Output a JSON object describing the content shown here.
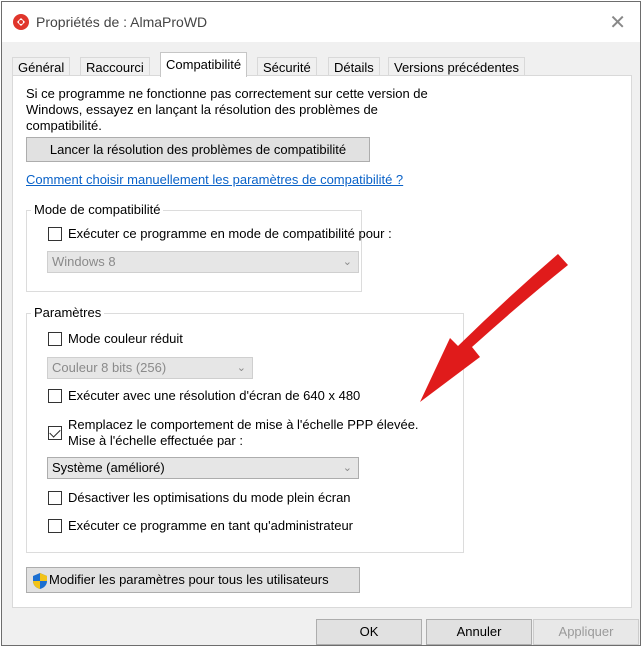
{
  "window": {
    "title": "Propriétés de : AlmaProWD",
    "close_glyph": "✕"
  },
  "tabs": [
    {
      "label": "Général"
    },
    {
      "label": "Raccourci"
    },
    {
      "label": "Compatibilité",
      "active": true
    },
    {
      "label": "Sécurité"
    },
    {
      "label": "Détails"
    },
    {
      "label": "Versions précédentes"
    }
  ],
  "intro_text": "Si ce programme ne fonctionne pas correctement sur cette version de Windows, essayez en lançant la résolution des problèmes de compatibilité.",
  "troubleshoot_button": "Lancer la résolution des problèmes de compatibilité",
  "manual_link": "Comment choisir manuellement les paramètres de compatibilité ?",
  "compat_mode": {
    "group_title": "Mode de compatibilité",
    "checkbox_label": "Exécuter ce programme en mode de compatibilité pour :",
    "checked": false,
    "select_value": "Windows 8"
  },
  "settings": {
    "group_title": "Paramètres",
    "reduced_color": {
      "label": "Mode couleur réduit",
      "checked": false
    },
    "color_select": "Couleur 8 bits (256)",
    "res_640": {
      "label": "Exécuter avec une résolution d'écran de 640 x 480",
      "checked": false
    },
    "dpi_override": {
      "label_line1": "Remplacez le comportement de mise à l'échelle PPP élevée.",
      "label_line2": "Mise à l'échelle effectuée par :",
      "checked": true
    },
    "dpi_select": "Système (amélioré)",
    "fullscreen_opt": {
      "label": "Désactiver les optimisations du mode plein écran",
      "checked": false
    },
    "run_admin": {
      "label": "Exécuter ce programme en tant qu'administrateur",
      "checked": false
    }
  },
  "all_users_button": "Modifier les paramètres pour tous les utilisateurs",
  "footer": {
    "ok": "OK",
    "cancel": "Annuler",
    "apply": "Appliquer"
  },
  "icons": [
    "app-icon",
    "close-icon",
    "shield-icon",
    "chevron-down-icon",
    "red-arrow-annotation"
  ],
  "colors": {
    "link": "#0a62c8",
    "arrow": "#e01b1b",
    "app_icon": "#e0352b"
  }
}
